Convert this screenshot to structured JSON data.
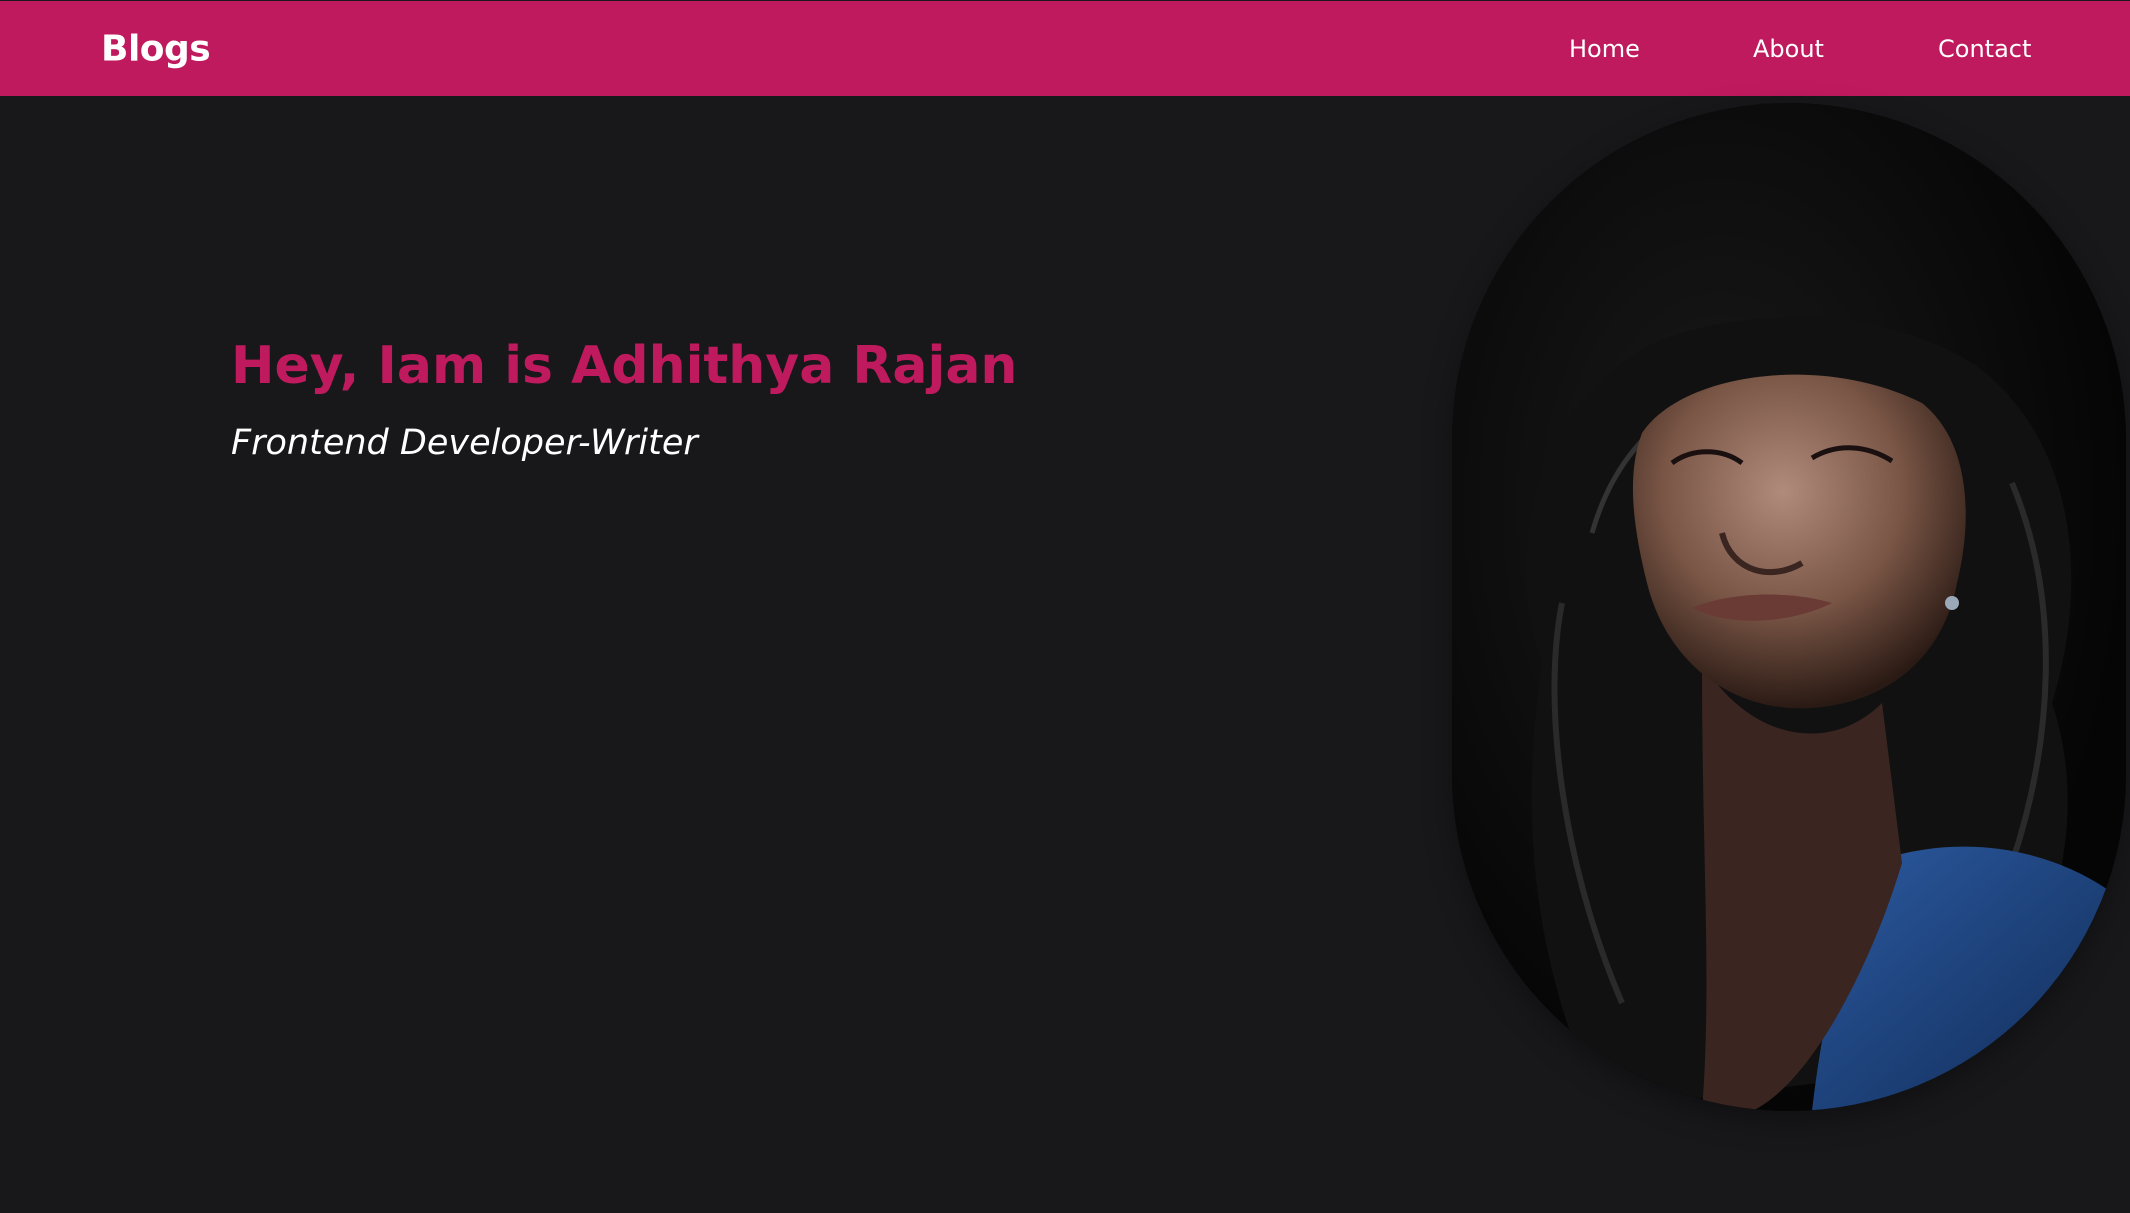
{
  "navbar": {
    "brand": "Blogs",
    "links": [
      {
        "label": "Home"
      },
      {
        "label": "About"
      },
      {
        "label": "Contact"
      }
    ]
  },
  "hero": {
    "heading": "Hey, Iam is Adhithya Rajan",
    "subtitle": "Frontend Developer-Writer"
  },
  "colors": {
    "accent": "#c01a5e",
    "background": "#18181b",
    "text": "#ffffff"
  }
}
